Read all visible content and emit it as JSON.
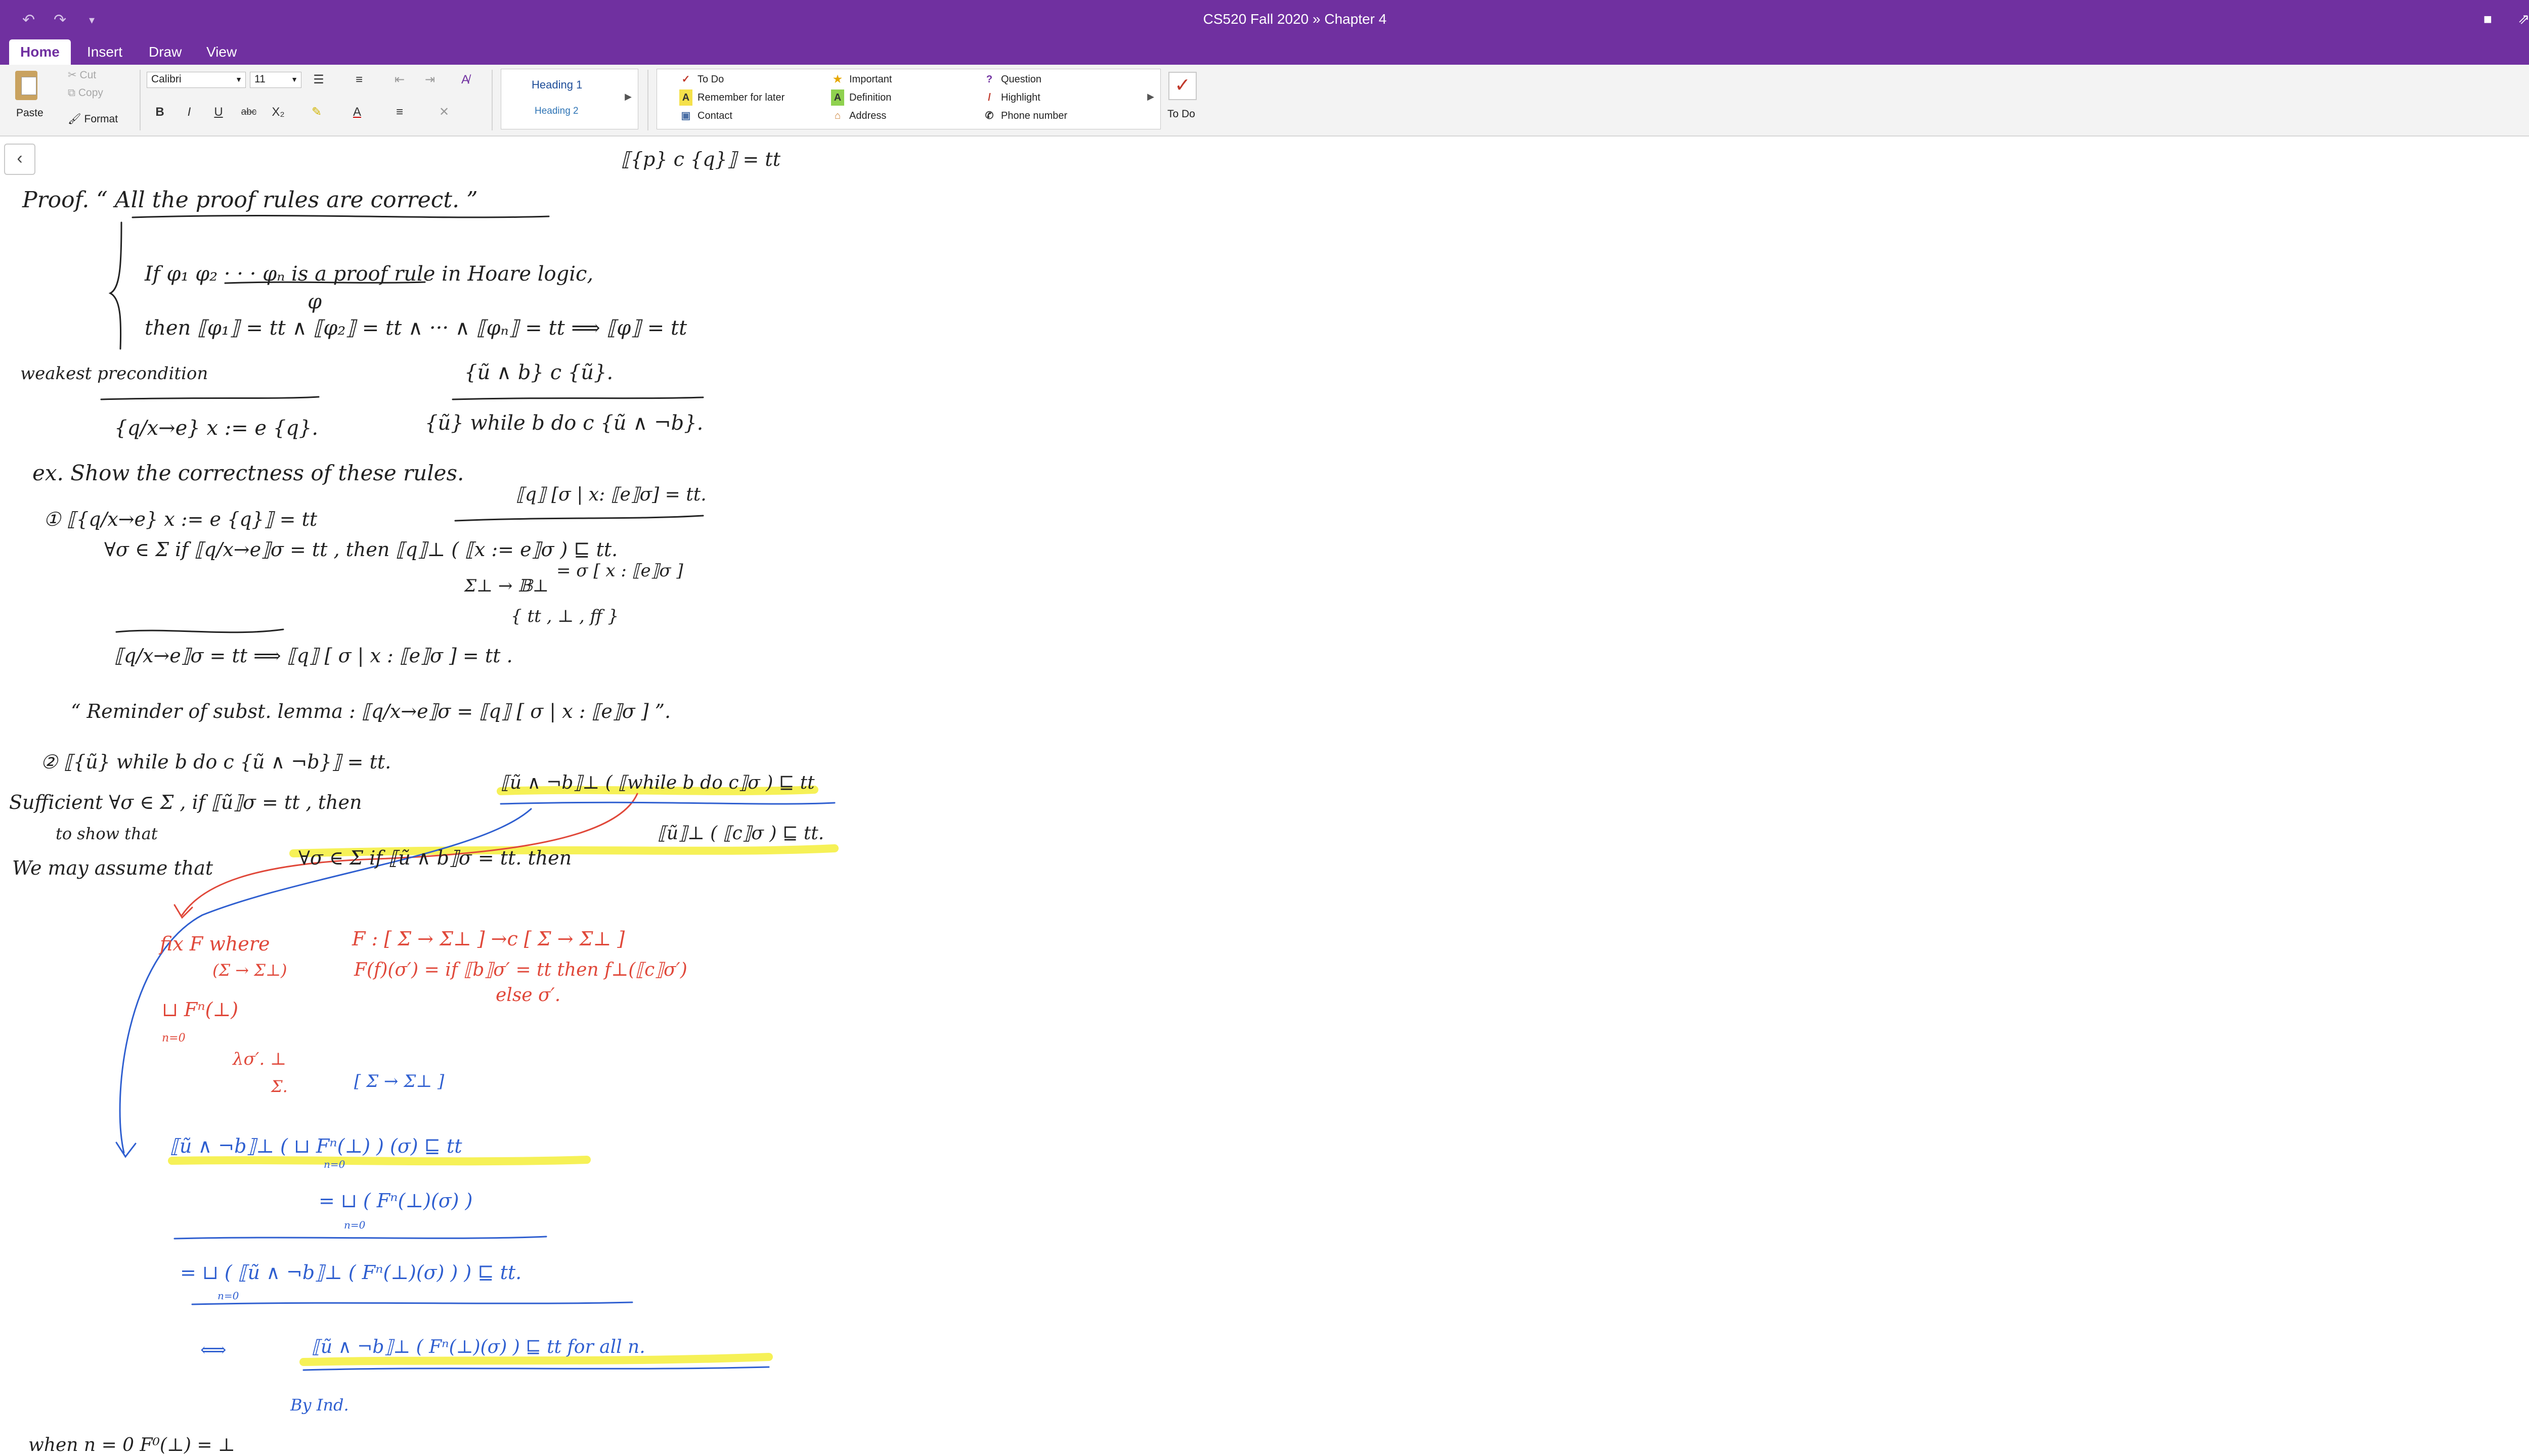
{
  "title_bar": {
    "notebook": "CS520 Fall 2020",
    "separator": "»",
    "section": "Chapter 4",
    "undo_icon": "undo-icon",
    "redo_icon": "redo-icon",
    "customize_icon": "chevron-down-icon",
    "bell_icon": "bell-icon",
    "share_icon": "share-icon",
    "collapse_icon": "collapse-icon"
  },
  "tabs": [
    "Home",
    "Insert",
    "Draw",
    "View"
  ],
  "ribbon": {
    "clipboard": {
      "paste": "Paste",
      "cut": "Cut",
      "copy": "Copy",
      "format": "Format"
    },
    "font": {
      "name": "Calibri",
      "size": "11"
    },
    "format_buttons": [
      "B",
      "I",
      "U",
      "abc",
      "X₂"
    ],
    "styles": {
      "heading1": "Heading 1",
      "heading2": "Heading 2"
    },
    "tags": [
      {
        "label": "To Do",
        "icon": "checkbox-icon"
      },
      {
        "label": "Remember for later",
        "icon": "remember-icon"
      },
      {
        "label": "Contact",
        "icon": "contact-icon"
      },
      {
        "label": "Important",
        "icon": "star-icon"
      },
      {
        "label": "Definition",
        "icon": "definition-icon"
      },
      {
        "label": "Address",
        "icon": "house-icon"
      },
      {
        "label": "Question",
        "icon": "question-icon"
      },
      {
        "label": "Highlight",
        "icon": "highlighter-icon"
      },
      {
        "label": "Phone number",
        "icon": "phone-icon"
      }
    ],
    "todo_button": "To Do"
  },
  "colors": {
    "accent": "#7030a0",
    "ink_black": "#222222",
    "ink_red": "#e0483a",
    "ink_blue": "#2f5fd0",
    "highlight_yellow": "#f5ef3a"
  },
  "handwriting": {
    "l01": "⟦{p} c {q}⟧ = tt",
    "l02": "Proof.  “ All the proof rules are correct. ”",
    "l03": "If   φ₁  φ₂  ·  ·  ·  φₙ   is a proof rule in Hoare logic,",
    "l04": "φ",
    "l05": "then   ⟦φ₁⟧ = tt  ∧  ⟦φ₂⟧ = tt  ∧  ···  ∧  ⟦φₙ⟧ = tt   ⟹   ⟦φ⟧ = tt",
    "l06": "weakest   precondition",
    "l07": "{ũ ∧ b} c {ũ}.",
    "l08": "{q/x→e}  x := e  {q}.",
    "l09": "{ũ} while b do c {ũ ∧ ¬b}.",
    "l10": "ex.  Show the correctness of these rules.",
    "l11": "⟦q⟧ [σ | x: ⟦e⟧σ] = tt.",
    "l12": "①   ⟦{q/x→e} x := e {q}⟧ = tt",
    "l13": "∀σ ∈ Σ   if  ⟦q/x→e⟧σ = tt ,  then   ⟦q⟧⊥ ( ⟦x := e⟧σ ) ⊑ tt.",
    "l14": "= σ [ x : ⟦e⟧σ ]",
    "l15": "Σ⊥ → 𝔹⊥",
    "l16": "{ tt , ⊥ , ff }",
    "l17": "⟦q/x→e⟧σ = tt     ⟹     ⟦q⟧ [ σ | x : ⟦e⟧σ ] = tt .",
    "l18": "“ Reminder of subst. lemma :     ⟦q/x→e⟧σ  =  ⟦q⟧ [ σ | x : ⟦e⟧σ ]  ”.",
    "l19": "②   ⟦{ũ} while b do c {ũ ∧ ¬b}⟧ = tt.",
    "l20": "Sufficient   ∀σ ∈ Σ ,   if  ⟦ũ⟧σ = tt ,  then",
    "l21": "⟦ũ ∧ ¬b⟧⊥ ( ⟦while b do c⟧σ ) ⊑ tt",
    "l22": "to show that",
    "l23": "⟦ũ⟧⊥ ( ⟦c⟧σ ) ⊑ tt.",
    "l24": "We may assume that",
    "l25": "∀σ ∈ Σ  if  ⟦ũ ∧ b⟧σ = tt.  then",
    "r01": "fix F     where",
    "r02": "F : [ Σ → Σ⊥ ] →c [ Σ → Σ⊥ ]",
    "r03": "(Σ → Σ⊥)",
    "r04": "F(f)(σ′) = if ⟦b⟧σ′ = tt then f⊥(⟦c⟧σ′)",
    "r05": "else σ′.",
    "r06": "⊔ Fⁿ(⊥)",
    "r07": "n=0",
    "r08": "λσ′. ⊥",
    "r09": "Σ.",
    "b01": "[ Σ → Σ⊥ ]",
    "b02": "⟦ũ ∧ ¬b⟧⊥ (  ⊔ Fⁿ(⊥) ) (σ)   ⊑ tt",
    "b03": "n=0",
    "b04": "= ⊔ ( Fⁿ(⊥)(σ) )",
    "b05": "n=0",
    "b06": "= ⊔ ( ⟦ũ ∧ ¬b⟧⊥ ( Fⁿ(⊥)(σ) ) )   ⊑ tt.",
    "b07": "n=0",
    "b08": "⟺",
    "b09": "⟦ũ ∧ ¬b⟧⊥ ( Fⁿ(⊥)(σ) ) ⊑ tt   for all n.",
    "b10": "By Ind.",
    "b11": "when n = 0    F⁰(⊥) = ⊥"
  }
}
